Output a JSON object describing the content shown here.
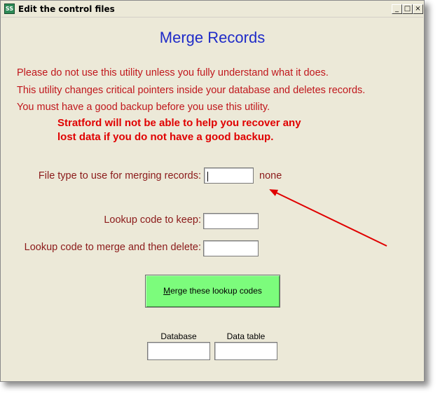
{
  "window": {
    "title": "Edit the control files",
    "app_icon_text": "SS",
    "minimize_glyph": "_",
    "maximize_glyph": "□",
    "close_glyph": "×"
  },
  "main": {
    "heading": "Merge Records",
    "warnings": [
      "Please do not use this utility unless you fully understand what it does.",
      "This utility changes critical pointers inside your database and deletes records.",
      "You must have a good backup before you use this utility."
    ],
    "bold_warnings": [
      "Stratford will not be able to help you recover any",
      "lost data if you do not have a good backup."
    ],
    "file_type": {
      "label": "File type to use for merging records:",
      "value": "",
      "status": "none"
    },
    "lookup_keep": {
      "label": "Lookup code to keep:",
      "value": ""
    },
    "lookup_merge": {
      "label": "Lookup code to merge and then delete:",
      "value": ""
    },
    "merge_button": {
      "accel": "M",
      "label_rest": "erge these lookup codes"
    },
    "database": {
      "label": "Database",
      "value": ""
    },
    "data_table": {
      "label": "Data table",
      "value": ""
    }
  },
  "colors": {
    "heading": "#1f2bc8",
    "warning": "#c0171c",
    "label": "#8b1a1a",
    "button_bg": "#7cfc7c",
    "arrow": "#e00000"
  }
}
